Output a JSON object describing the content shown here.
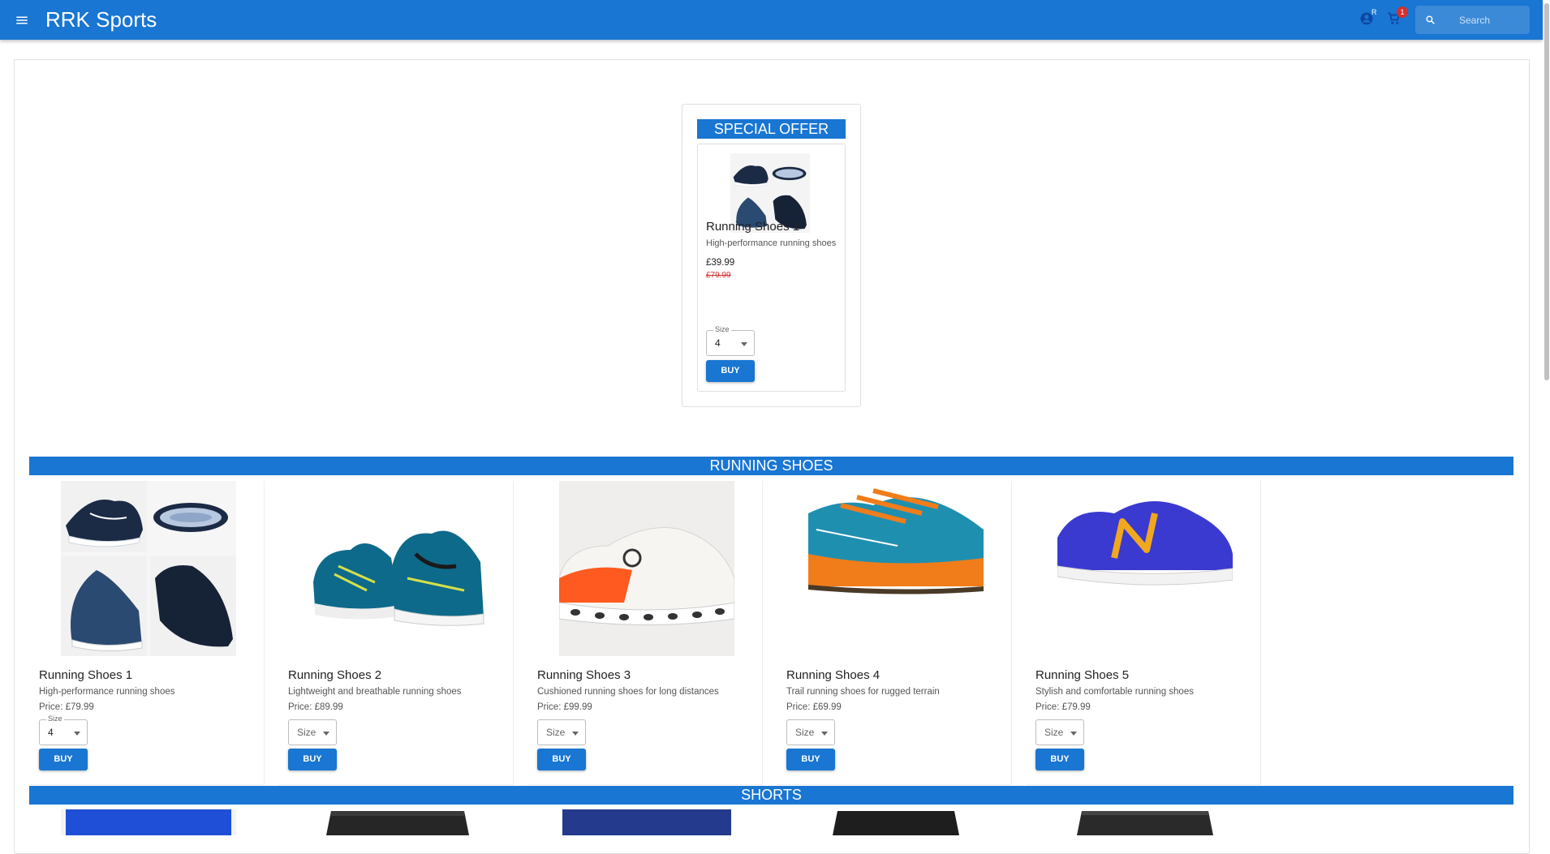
{
  "header": {
    "brand": "RRK Sports",
    "account_badge": "R",
    "cart_count": "1",
    "search_placeholder": "Search"
  },
  "special_offer": {
    "banner": "SPECIAL OFFER",
    "product": {
      "title": "Running Shoes 1",
      "description": "High-performance running shoes",
      "price": "£39.99",
      "old_price": "£79.99",
      "size_label": "Size",
      "size_value": "4",
      "buy_label": "BUY"
    }
  },
  "sections": [
    {
      "title": "RUNNING SHOES",
      "products": [
        {
          "title": "Running Shoes 1",
          "description": "High-performance running shoes",
          "price": "Price: £79.99",
          "size_label": "Size",
          "size_value": "4",
          "buy_label": "BUY"
        },
        {
          "title": "Running Shoes 2",
          "description": "Lightweight and breathable running shoes",
          "price": "Price: £89.99",
          "size_placeholder": "Size",
          "buy_label": "BUY"
        },
        {
          "title": "Running Shoes 3",
          "description": "Cushioned running shoes for long distances",
          "price": "Price: £99.99",
          "size_placeholder": "Size",
          "buy_label": "BUY"
        },
        {
          "title": "Running Shoes 4",
          "description": "Trail running shoes for rugged terrain",
          "price": "Price: £69.99",
          "size_placeholder": "Size",
          "buy_label": "BUY"
        },
        {
          "title": "Running Shoes 5",
          "description": "Stylish and comfortable running shoes",
          "price": "Price: £79.99",
          "size_placeholder": "Size",
          "buy_label": "BUY"
        }
      ]
    },
    {
      "title": "SHORTS",
      "products": []
    }
  ],
  "colors": {
    "primary": "#1976d2",
    "badge": "#d32f2f",
    "old_price": "#d32f2f"
  },
  "icons": [
    "menu-icon",
    "account-icon",
    "cart-icon",
    "search-icon",
    "chevron-down-icon"
  ]
}
